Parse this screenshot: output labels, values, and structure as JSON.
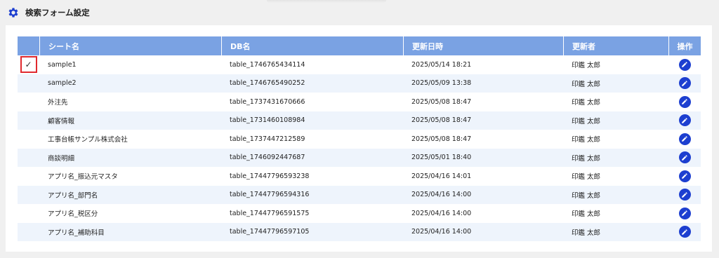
{
  "header": {
    "title": "検索フォーム設定",
    "icon": "gear-icon"
  },
  "table": {
    "columns": [
      "",
      "シート名",
      "DB名",
      "更新日時",
      "更新者",
      "操作"
    ],
    "rows": [
      {
        "selected": true,
        "sheet": "sample1",
        "db": "table_1746765434114",
        "updated": "2025/05/14 18:21",
        "user": "印鑑 太郎"
      },
      {
        "selected": false,
        "sheet": "sample2",
        "db": "table_1746765490252",
        "updated": "2025/05/09 13:38",
        "user": "印鑑 太郎"
      },
      {
        "selected": false,
        "sheet": "外注先",
        "db": "table_1737431670666",
        "updated": "2025/05/08 18:47",
        "user": "印鑑 太郎"
      },
      {
        "selected": false,
        "sheet": "顧客情報",
        "db": "table_1731460108984",
        "updated": "2025/05/08 18:47",
        "user": "印鑑 太郎"
      },
      {
        "selected": false,
        "sheet": "工事台帳サンプル株式会社",
        "db": "table_1737447212589",
        "updated": "2025/05/08 18:47",
        "user": "印鑑 太郎"
      },
      {
        "selected": false,
        "sheet": "商談明細",
        "db": "table_1746092447687",
        "updated": "2025/05/01 18:40",
        "user": "印鑑 太郎"
      },
      {
        "selected": false,
        "sheet": "アプリ名_振込元マスタ",
        "db": "table_17447796593238",
        "updated": "2025/04/16 14:01",
        "user": "印鑑 太郎"
      },
      {
        "selected": false,
        "sheet": "アプリ名_部門名",
        "db": "table_17447796594316",
        "updated": "2025/04/16 14:00",
        "user": "印鑑 太郎"
      },
      {
        "selected": false,
        "sheet": "アプリ名_税区分",
        "db": "table_17447796591575",
        "updated": "2025/04/16 14:00",
        "user": "印鑑 太郎"
      },
      {
        "selected": false,
        "sheet": "アプリ名_補助科目",
        "db": "table_17447796597105",
        "updated": "2025/04/16 14:00",
        "user": "印鑑 太郎"
      }
    ],
    "check_mark": "✓",
    "edit_icon": "pencil-icon"
  },
  "colors": {
    "header_bg": "#7aa2e3",
    "row_alt": "#eef4fc",
    "edit_button": "#1d3fd0",
    "selection_border": "#e0292e",
    "gear": "#1d3fd0"
  }
}
